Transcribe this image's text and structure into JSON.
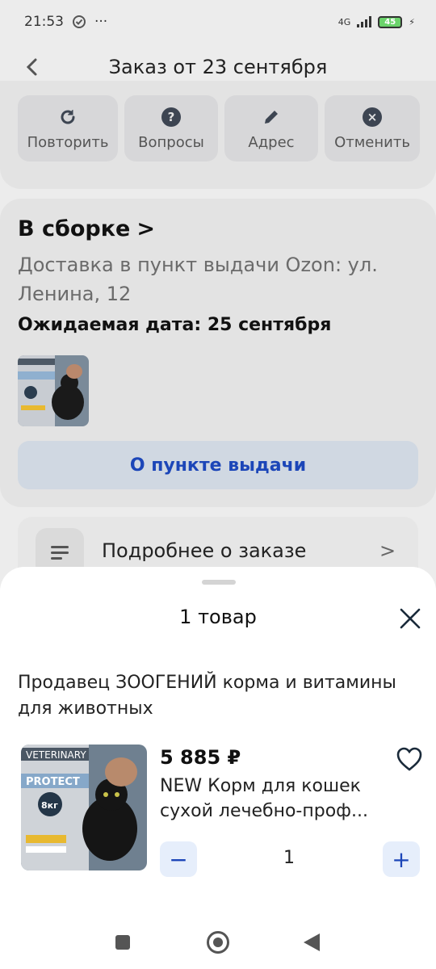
{
  "status_bar": {
    "time": "21:53",
    "network": "4G",
    "battery": "45"
  },
  "header": {
    "title": "Заказ от 23 сентября"
  },
  "actions": [
    {
      "label": "Повторить",
      "icon": "repeat-icon"
    },
    {
      "label": "Вопросы",
      "icon": "question-icon"
    },
    {
      "label": "Адрес",
      "icon": "pencil-icon"
    },
    {
      "label": "Отменить",
      "icon": "cancel-icon"
    }
  ],
  "order_status": {
    "title": "В сборке",
    "delivery": "Доставка в пункт выдачи Ozon: ул. Ленина, 12",
    "expected_date": "Ожидаемая дата: 25 сентября",
    "pickup_button": "О пункте выдачи"
  },
  "details": {
    "label": "Подробнее о заказе"
  },
  "sheet": {
    "title": "1 товар",
    "seller": "Продавец ЗООГЕНИЙ корма и витамины для животных",
    "product": {
      "image_text": "VETERINARY",
      "image_brand": "PROTECT",
      "image_weight": "8кг",
      "price": "5 885 ₽",
      "name": "NEW Корм для кошек сухой лечебно-проф...",
      "quantity": "1"
    }
  },
  "colors": {
    "accent": "#1c46b8",
    "accent_bg": "#e6eefb",
    "overlay_bg": "#ececec"
  }
}
